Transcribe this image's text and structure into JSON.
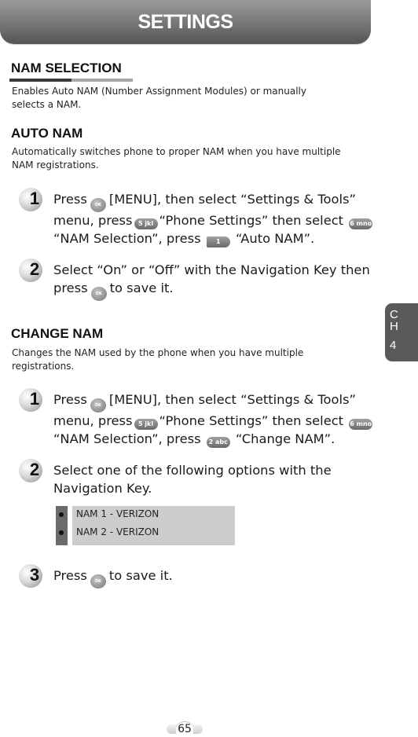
{
  "header": {
    "title": "SETTINGS"
  },
  "sections": {
    "nam_selection": {
      "title": "NAM SELECTION",
      "description_line1": "Enables Auto NAM (Number Assignment Modules) or manually",
      "description_line2": "selects a NAM."
    },
    "auto_nam": {
      "title": "AUTO NAM",
      "description_line1": "Automatically switches phone to proper NAM when you have multiple",
      "description_line2": "NAM registrations.",
      "steps": [
        {
          "number": "1",
          "parts": [
            "Press",
            "[MENU], then select “Settings & Tools”",
            "menu, press",
            "“Phone Settings” then select",
            "“NAM Selection”, press",
            "“Auto NAM”."
          ],
          "keys": [
            "OK",
            "5 jkl",
            "6 mno",
            "1"
          ]
        },
        {
          "number": "2",
          "line1": "Select “On” or “Off” with the Navigation Key then",
          "line2_pre": "press",
          "line2_post": "to save it.",
          "key": "OK"
        }
      ]
    },
    "change_nam": {
      "title": "CHANGE NAM",
      "description_line1": "Changes the NAM used by the phone when you have multiple",
      "description_line2": "registrations.",
      "steps": [
        {
          "number": "1",
          "parts": [
            "Press",
            "[MENU], then select “Settings & Tools”",
            "menu, press",
            "“Phone Settings” then select",
            "“NAM Selection”, press",
            "“Change NAM”."
          ],
          "keys": [
            "OK",
            "5 jkl",
            "6 mno",
            "2 abc"
          ]
        },
        {
          "number": "2",
          "line1": "Select one of the following options with the",
          "line2": "Navigation Key.",
          "options": [
            "NAM 1 - VERIZON",
            "NAM 2 - VERIZON"
          ]
        },
        {
          "number": "3",
          "pre": "Press",
          "post": "to save it.",
          "key": "OK"
        }
      ]
    }
  },
  "chapter_tab": {
    "c": "C",
    "h": "H",
    "num": "4"
  },
  "footer": {
    "page_number": "65"
  }
}
